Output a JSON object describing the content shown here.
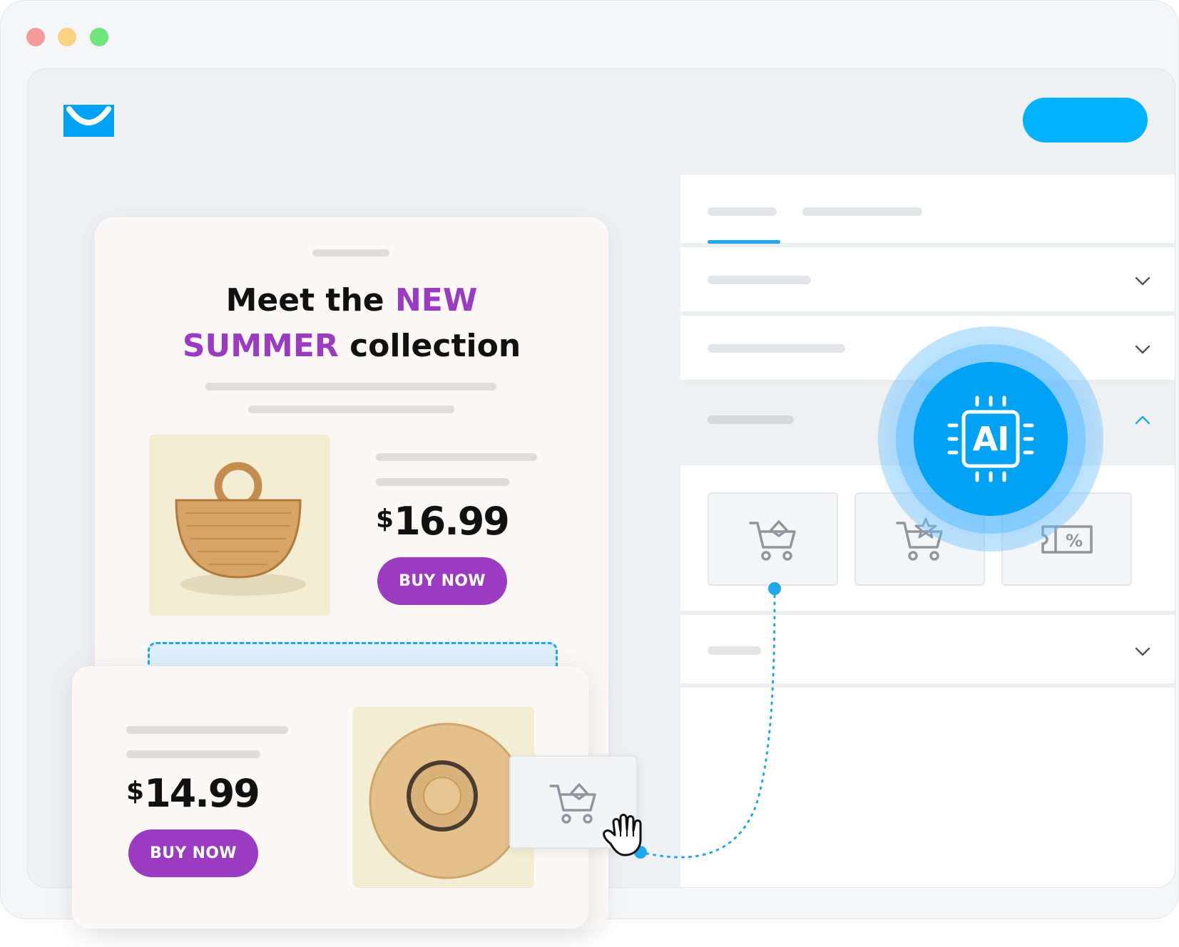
{
  "window": {
    "controls": [
      "close",
      "minimize",
      "maximize"
    ]
  },
  "header": {
    "logo_icon": "smile-envelope-icon",
    "cta_label": ""
  },
  "sidebar": {
    "tabs": [
      {
        "label": "",
        "active": true
      },
      {
        "label": "",
        "active": false
      }
    ],
    "sections": [
      {
        "label": "",
        "state": "collapsed"
      },
      {
        "label": "",
        "state": "collapsed"
      },
      {
        "label": "",
        "state": "expanded"
      },
      {
        "label": "",
        "state": "collapsed"
      }
    ],
    "tiles": [
      {
        "icon": "cart-box-icon"
      },
      {
        "icon": "cart-star-icon"
      },
      {
        "icon": "discount-ticket-icon"
      }
    ]
  },
  "ai_badge": {
    "label": "AI",
    "icon": "chip-icon"
  },
  "email": {
    "headline_part1": "Meet the ",
    "headline_accent1": "NEW",
    "headline_accent2": "SUMMER",
    "headline_part2": " collection",
    "product1": {
      "image": "straw-basket-bag",
      "currency": "$",
      "price": "16.99",
      "button": "BUY NOW"
    },
    "product2": {
      "image": "straw-sun-hat",
      "currency": "$",
      "price": "14.99",
      "button": "BUY NOW"
    }
  },
  "drag": {
    "icon": "cart-box-icon",
    "cursor": "hand-grab-icon"
  },
  "colors": {
    "brand_blue": "#00a2f5",
    "cta_blue": "#00b2ff",
    "accent_purple": "#9a3bc2",
    "drop_zone_border": "#24a7ec"
  }
}
